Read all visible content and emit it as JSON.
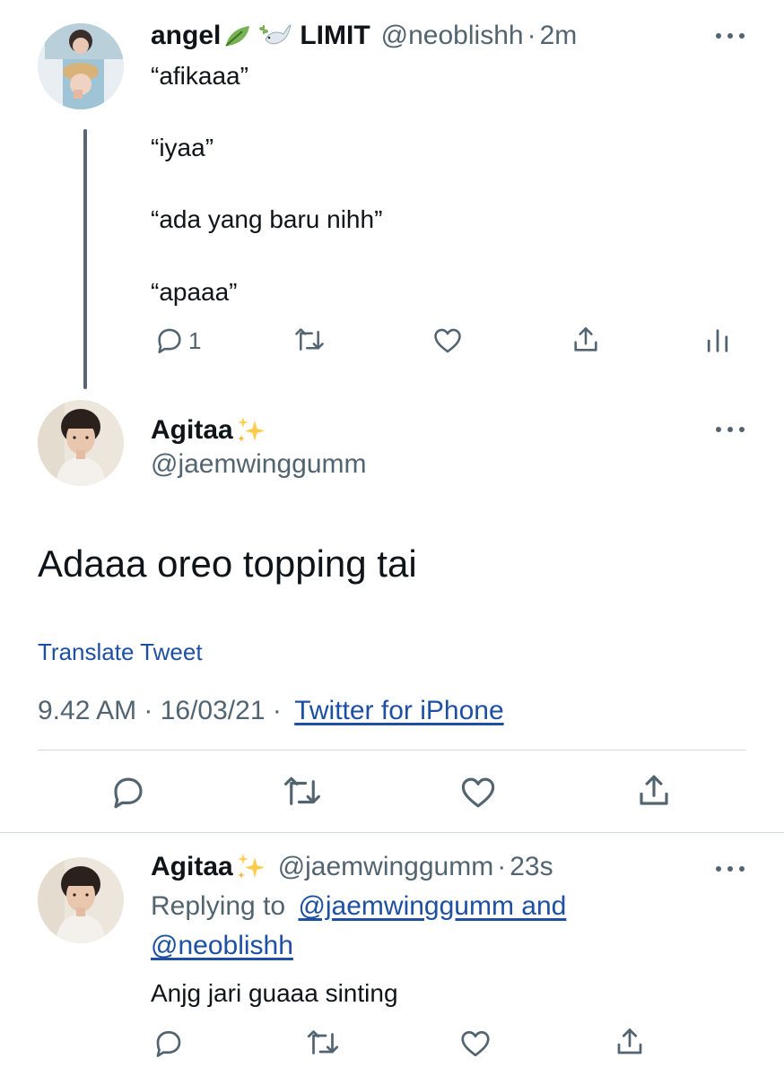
{
  "tweet1": {
    "display_name": "angel",
    "name_suffix": "LIMIT",
    "handle": "@neoblishh",
    "separator": "·",
    "time": "2m",
    "lines": [
      "“afikaaa”",
      "“iyaa”",
      "“ada yang baru nihh”",
      "“apaaa”"
    ],
    "reply_count": "1"
  },
  "main_tweet": {
    "display_name": "Agitaa",
    "handle": "@jaemwinggumm",
    "text": "Adaaa oreo topping tai",
    "translate_label": "Translate Tweet",
    "timestamp": "9.42 AM · 16/03/21 ·",
    "source": "Twitter for iPhone"
  },
  "reply_tweet": {
    "display_name": "Agitaa",
    "handle": "@jaemwinggumm",
    "separator": "·",
    "time": "23s",
    "replying_prefix": "Replying to",
    "replying_to_1": "@jaemwinggumm and",
    "replying_to_2": "@neoblishh",
    "text": "Anjg jari guaaa sinting"
  },
  "colors": {
    "text": "#0f1419",
    "secondary": "#536471",
    "link": "#1d4fa3",
    "divider": "#cfd9de",
    "thread_line": "#5b6670"
  }
}
